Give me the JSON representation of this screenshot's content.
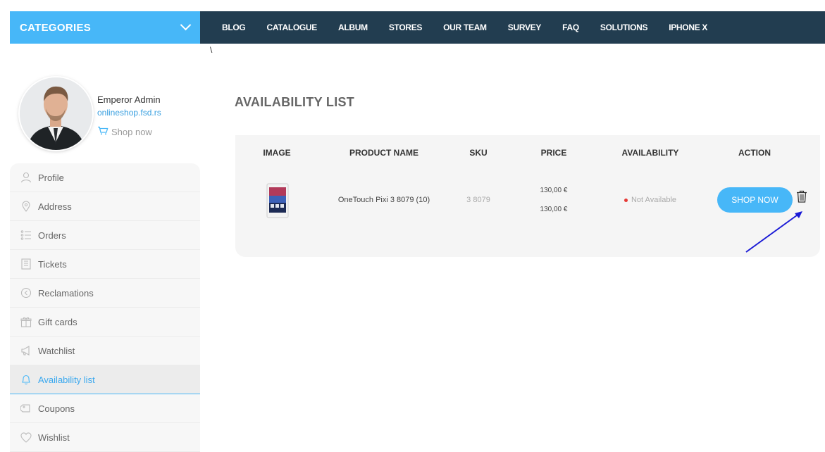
{
  "topbar": {
    "categories_label": "CATEGORIES",
    "nav": [
      "BLOG",
      "CATALOGUE",
      "ALBUM",
      "STORES",
      "OUR TEAM",
      "SURVEY",
      "FAQ",
      "SOLUTIONS",
      "IPHONE X"
    ]
  },
  "breadcrumb_sep": "\\",
  "user": {
    "name": "Emperor Admin",
    "site": "onlineshop.fsd.rs",
    "shop_now": "Shop now"
  },
  "sidebar": {
    "items": [
      {
        "label": "Profile",
        "icon": "user-icon"
      },
      {
        "label": "Address",
        "icon": "location-pin-icon"
      },
      {
        "label": "Orders",
        "icon": "list-icon"
      },
      {
        "label": "Tickets",
        "icon": "ticket-icon"
      },
      {
        "label": "Reclamations",
        "icon": "return-icon"
      },
      {
        "label": "Gift cards",
        "icon": "gift-icon"
      },
      {
        "label": "Watchlist",
        "icon": "megaphone-icon"
      },
      {
        "label": "Availability list",
        "icon": "bell-icon",
        "active": true
      },
      {
        "label": "Coupons",
        "icon": "tag-icon"
      },
      {
        "label": "Wishlist",
        "icon": "heart-icon"
      }
    ]
  },
  "main": {
    "title": "AVAILABILITY LIST",
    "columns": [
      "IMAGE",
      "PRODUCT NAME",
      "SKU",
      "PRICE",
      "AVAILABILITY",
      "ACTION"
    ],
    "rows": [
      {
        "product_name": "OneTouch Pixi 3 8079 (10)",
        "sku": "3 8079",
        "price_old": "130,00 €",
        "price_new": "130,00 €",
        "availability": "Not Available",
        "action_label": "SHOP NOW"
      }
    ]
  },
  "colors": {
    "accent": "#47b7f8",
    "nav_bg": "#223d50",
    "not_available": "#e53935",
    "annotation_arrow": "#1a1ad6"
  }
}
